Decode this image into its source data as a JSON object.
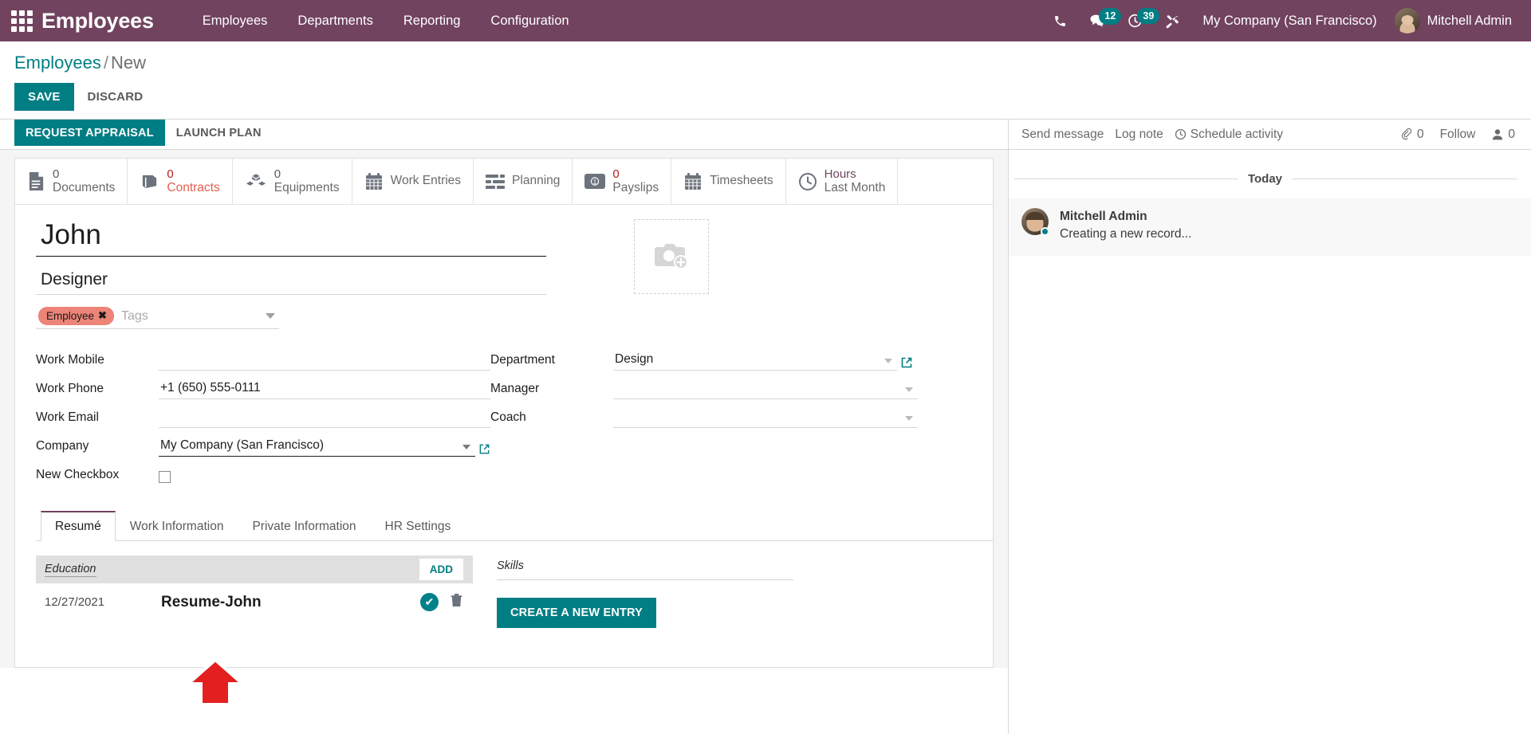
{
  "navbar": {
    "apps_icon": "apps-grid-icon",
    "brand": "Employees",
    "menu": [
      {
        "label": "Employees"
      },
      {
        "label": "Departments"
      },
      {
        "label": "Reporting"
      },
      {
        "label": "Configuration"
      }
    ],
    "icons": [
      {
        "name": "phone-icon",
        "badge": null
      },
      {
        "name": "messages-icon",
        "badge": "12"
      },
      {
        "name": "activities-clock-icon",
        "badge": "39"
      },
      {
        "name": "debug-tools-icon",
        "badge": null
      }
    ],
    "company": "My Company (San Francisco)",
    "user": "Mitchell Admin",
    "accent_teal": "#017e84",
    "brand_purple": "#71435f"
  },
  "control_panel": {
    "breadcrumb_root": "Employees",
    "breadcrumb_sep": "/",
    "breadcrumb_current": "New",
    "save_label": "SAVE",
    "discard_label": "DISCARD"
  },
  "action_buttons": {
    "primary": "REQUEST APPRAISAL",
    "secondary": "LAUNCH PLAN"
  },
  "stat_buttons": [
    {
      "value": "0",
      "label": "Documents",
      "icon": "document-icon",
      "value_color": "gray",
      "label_color": "gray"
    },
    {
      "value": "0",
      "label": "Contracts",
      "icon": "book-icon",
      "value_color": "red",
      "label_color": "red"
    },
    {
      "value": "0",
      "label": "Equipments",
      "icon": "boxes-icon",
      "value_color": "gray",
      "label_color": "gray"
    },
    {
      "value": "",
      "label": "Work Entries",
      "icon": "calendar-icon",
      "value_color": "gray",
      "label_color": "gray"
    },
    {
      "value": "",
      "label": "Planning",
      "icon": "planning-bars-icon",
      "value_color": "gray",
      "label_color": "gray"
    },
    {
      "value": "0",
      "label": "Payslips",
      "icon": "money-icon",
      "value_color": "red",
      "label_color": "gray"
    },
    {
      "value": "",
      "label": "Timesheets",
      "icon": "calendar-icon",
      "value_color": "gray",
      "label_color": "gray"
    },
    {
      "value": "Hours",
      "label": "Last Month",
      "icon": "clock-icon",
      "value_color": "purple",
      "label_color": "gray"
    }
  ],
  "form": {
    "employee_name": "John",
    "employee_name_placeholder": "Employee's Name",
    "job_position": "Designer",
    "job_position_placeholder": "Job Position",
    "tags": [
      {
        "label": "Employee",
        "color": "#ec8477"
      }
    ],
    "tags_placeholder": "Tags",
    "photo_placeholder_icon": "add-photo-icon",
    "left_fields": [
      {
        "label": "Work Mobile",
        "value": "",
        "type": "text"
      },
      {
        "label": "Work Phone",
        "value": "+1 (650) 555-0111",
        "type": "text"
      },
      {
        "label": "Work Email",
        "value": "",
        "type": "text"
      },
      {
        "label": "Company",
        "value": "My Company (San Francisco)",
        "type": "many2one"
      },
      {
        "label": "New Checkbox",
        "value": "",
        "type": "checkbox",
        "checked": false
      }
    ],
    "right_fields": [
      {
        "label": "Department",
        "value": "Design",
        "type": "many2one_ext"
      },
      {
        "label": "Manager",
        "value": "",
        "type": "many2one"
      },
      {
        "label": "Coach",
        "value": "",
        "type": "many2one"
      }
    ]
  },
  "notebook": {
    "tabs": [
      {
        "label": "Resumé",
        "active": true
      },
      {
        "label": "Work Information",
        "active": false
      },
      {
        "label": "Private Information",
        "active": false
      },
      {
        "label": "HR Settings",
        "active": false
      }
    ]
  },
  "resume": {
    "section_title": "Education",
    "add_label": "ADD",
    "rows": [
      {
        "date": "12/27/2021",
        "name": "Resume-John"
      }
    ]
  },
  "skills": {
    "section_title": "Skills",
    "create_label": "CREATE A NEW ENTRY"
  },
  "chatter": {
    "send_message": "Send message",
    "log_note": "Log note",
    "schedule_activity": "Schedule activity",
    "attachment_count": "0",
    "follow_label": "Follow",
    "follower_count": "0",
    "day_separator": "Today",
    "messages": [
      {
        "author": "Mitchell Admin",
        "body": "Creating a new record..."
      }
    ]
  }
}
